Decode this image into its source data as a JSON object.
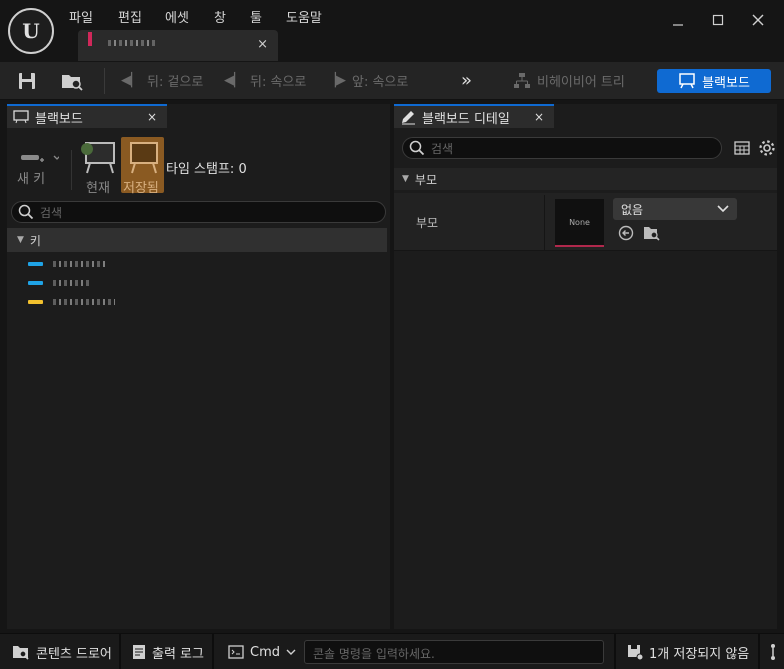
{
  "menu": [
    "파일",
    "편집",
    "에셋",
    "창",
    "툴",
    "도움말"
  ],
  "window_controls": [
    "minimize-icon",
    "maximize-icon",
    "close-icon"
  ],
  "asset_tab": {
    "close": "×"
  },
  "toolbar": {
    "back_show": "뒤: 겉으로",
    "back_inside": "뒤: 속으로",
    "forward_inside": "앞: 속으로",
    "behavior_tree": "비헤이비어 트리",
    "blackboard": "블랙보드"
  },
  "left_panel": {
    "tab": "블랙보드",
    "close": "×",
    "new_key": "새 키",
    "current": "현재",
    "saved": "저장됨",
    "timestamp": "타임 스탬프: 0",
    "search_placeholder": "검색",
    "keys_header": "키",
    "keys": [
      {
        "color": "#1fa3e6"
      },
      {
        "color": "#1fa3e6"
      },
      {
        "color": "#f2c12e"
      }
    ]
  },
  "right_panel": {
    "tab": "블랙보드 디테일",
    "close": "×",
    "search_placeholder": "검색",
    "section": "부모",
    "property_label": "부모",
    "thumb_label": "None",
    "dropdown_value": "없음"
  },
  "bottom": {
    "content_drawer": "콘텐츠 드로어",
    "output_log": "출력 로그",
    "cmd": "Cmd",
    "console_placeholder": "콘솔 명령을 입력하세요.",
    "unsaved": "1개 저장되지 않음"
  },
  "colors": {
    "accent": "#0f6ad2",
    "saved_bg": "#8a5a22"
  }
}
